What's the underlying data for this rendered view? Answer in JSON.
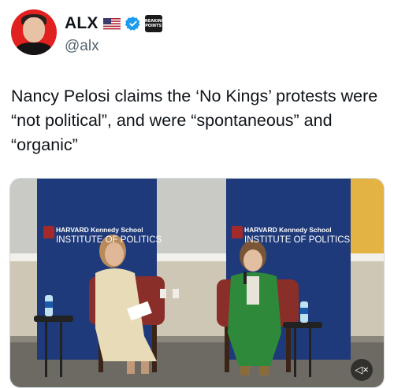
{
  "author": {
    "display_name": "ALX",
    "handle": "@alx",
    "avatar": "avatar-image",
    "flag_icon": "us-flag-icon",
    "verified_icon": "verified-badge-icon",
    "affiliate_badge": "BREAKING POINTS",
    "verified_color": "#1d9bf0"
  },
  "tweet": {
    "text": "Nancy Pelosi claims the ‘No Kings’ protests were “not political”, and were “spontaneous” and “organic”"
  },
  "media": {
    "banner_left": {
      "line1": "HARVARD Kennedy School",
      "line2": "INSTITUTE OF POLITICS"
    },
    "banner_right": {
      "line1": "HARVARD Kennedy School",
      "line2": "INSTITUTE OF POLITICS"
    },
    "mute_icon": "speaker-muted-icon",
    "mute_label": "◁×"
  }
}
